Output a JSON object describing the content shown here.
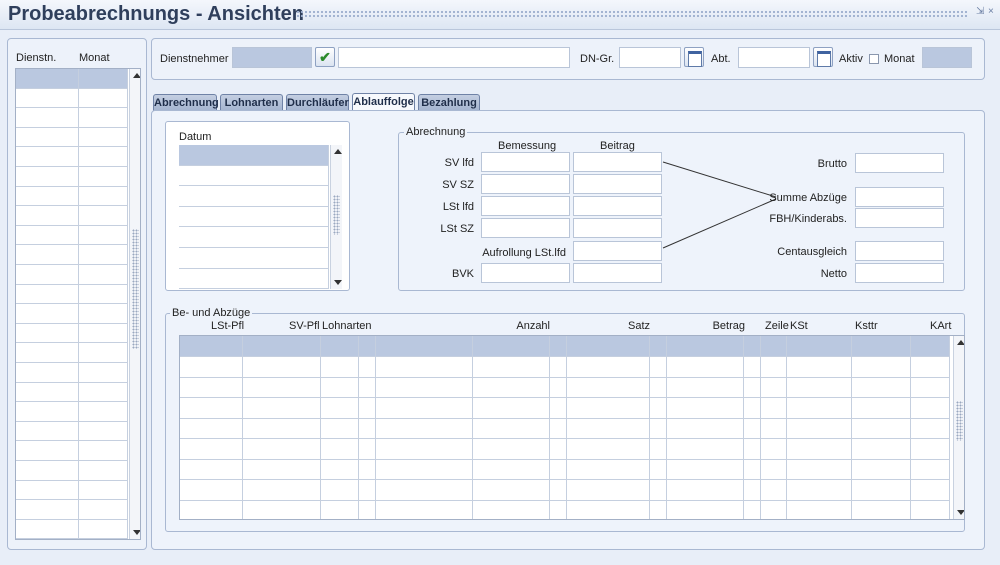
{
  "window": {
    "title": "Probeabrechnungs - Ansichten",
    "minimize_glyph": "⇲",
    "close_glyph": "×"
  },
  "left_list": {
    "columns": [
      "Dienstn.",
      "Monat"
    ]
  },
  "header": {
    "dienstnehmer_label": "Dienstnehmer",
    "dienstnehmer_id": "",
    "dienstnehmer_name": "",
    "dn_gr_label": "DN-Gr.",
    "dn_gr_value": "",
    "abt_label": "Abt.",
    "abt_value": "",
    "aktiv_label": "Aktiv",
    "monat_label": "Monat",
    "monat_value": "",
    "check_icon": "check-icon",
    "calendar_icon": "calendar-icon"
  },
  "tabs": [
    {
      "label": "Abrechnung"
    },
    {
      "label": "Lohnarten"
    },
    {
      "label": "Durchläufer"
    },
    {
      "label": "Ablauffolge"
    },
    {
      "label": "Bezahlung"
    }
  ],
  "datum": {
    "label": "Datum"
  },
  "abrechnung": {
    "legend": "Abrechnung",
    "bemessung_header": "Bemessung",
    "beitrag_header": "Beitrag",
    "rows": [
      {
        "label": "SV lfd"
      },
      {
        "label": "SV SZ"
      },
      {
        "label": "LSt lfd"
      },
      {
        "label": "LSt SZ"
      },
      {
        "label": "Aufrollung LSt.lfd"
      },
      {
        "label": "BVK"
      }
    ],
    "right": [
      {
        "label": "Brutto"
      },
      {
        "label": "Summe Abzüge"
      },
      {
        "label": "FBH/Kinderabs."
      },
      {
        "label": "Centausgleich"
      },
      {
        "label": "Netto"
      }
    ]
  },
  "be_abzuege": {
    "legend": "Be- und Abzüge",
    "columns": {
      "lst_pfl": "LSt-Pfl",
      "sv_pfl": "SV-Pfl",
      "lohnarten": "Lohnarten",
      "anzahl": "Anzahl",
      "satz": "Satz",
      "betrag": "Betrag",
      "zeile": "Zeile",
      "kst": "KSt",
      "ksttr": "Ksttr",
      "kart": "KArt"
    }
  }
}
